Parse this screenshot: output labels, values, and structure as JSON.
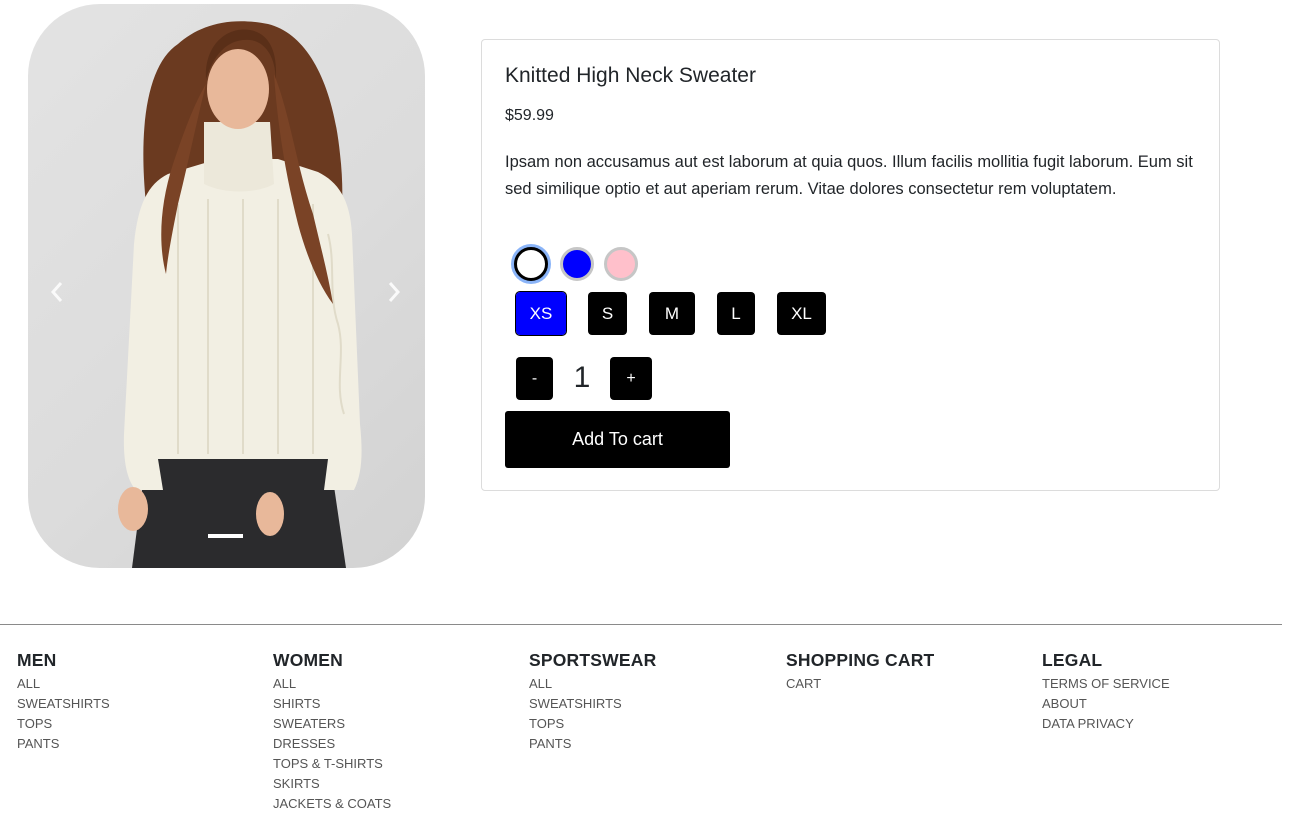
{
  "carousel": {
    "image": "woman-in-white-knitted-turtleneck-sweater",
    "prev_icon": "chevron-left-icon",
    "next_icon": "chevron-right-icon",
    "slide_count": 1,
    "active_slide": 1
  },
  "product": {
    "title": "Knitted High Neck Sweater",
    "price": "$59.99",
    "description": "Ipsam non accusamus aut est laborum at quia quos. Illum facilis mollitia fugit laborum. Eum sit sed similique optio et aut aperiam rerum. Vitae dolores consectetur rem voluptatem.",
    "colors": [
      {
        "value": "#ffffff",
        "selected": true
      },
      {
        "value": "#0000ff",
        "selected": false
      },
      {
        "value": "#ffc0cb",
        "selected": false
      }
    ],
    "sizes": [
      {
        "label": "XS",
        "selected": true
      },
      {
        "label": "S",
        "selected": false
      },
      {
        "label": "M",
        "selected": false
      },
      {
        "label": "L",
        "selected": false
      },
      {
        "label": "XL",
        "selected": false
      }
    ],
    "quantity": {
      "decrement": "-",
      "value": "1",
      "increment": "+"
    },
    "add_to_cart": "Add To cart"
  },
  "footer": {
    "columns": [
      {
        "heading": "MEN",
        "links": [
          "ALL",
          "SWEATSHIRTS",
          "TOPS",
          "PANTS"
        ]
      },
      {
        "heading": "WOMEN",
        "links": [
          "ALL",
          "SHIRTS",
          "SWEATERS",
          "DRESSES",
          "TOPS & T-SHIRTS",
          "SKIRTS",
          "JACKETS & COATS"
        ]
      },
      {
        "heading": "SPORTSWEAR",
        "links": [
          "ALL",
          "SWEATSHIRTS",
          "TOPS",
          "PANTS"
        ]
      },
      {
        "heading": "SHOPPING CART",
        "links": [
          "CART"
        ]
      },
      {
        "heading": "LEGAL",
        "links": [
          "TERMS OF SERVICE",
          "ABOUT",
          "DATA PRIVACY"
        ]
      }
    ]
  },
  "colors": {
    "accent": "#0000ff",
    "button": "#000000",
    "text": "#212529",
    "link": "#555555"
  }
}
